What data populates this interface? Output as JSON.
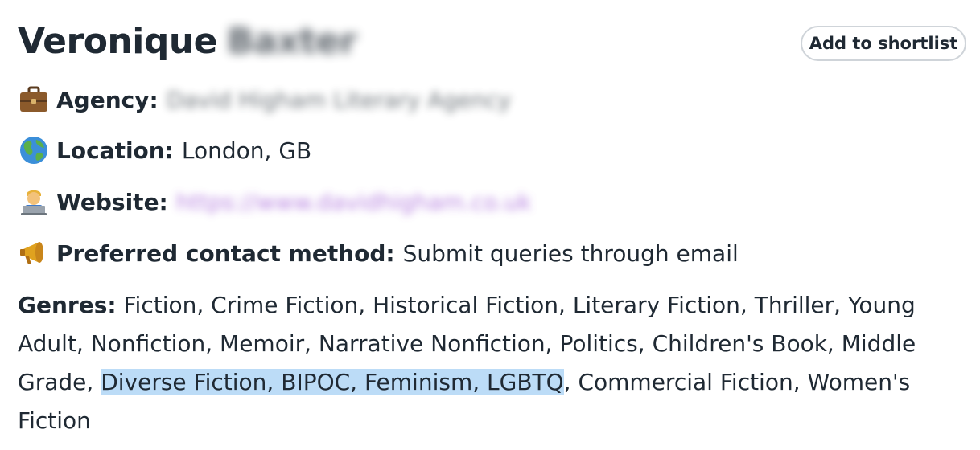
{
  "agent": {
    "first_name": "Veronique",
    "surname_blurred": "Baxter"
  },
  "shortlist_button": {
    "label": "Add to shortlist"
  },
  "fields": {
    "agency": {
      "icon": "briefcase-icon",
      "label": "Agency:",
      "value_blurred": "David Higham Literary Agency"
    },
    "location": {
      "icon": "globe-icon",
      "label": "Location:",
      "value": "London, GB"
    },
    "website": {
      "icon": "technologist-icon",
      "label": "Website:",
      "value_blurred": "https://www.davidhigham.co.uk"
    },
    "contact": {
      "icon": "megaphone-icon",
      "label": "Preferred contact method:",
      "value": "Submit queries through email"
    }
  },
  "genres": {
    "label": "Genres:",
    "before_highlight": "Fiction, Crime Fiction, Historical Fiction, Literary Fiction, Thriller, Young Adult, Nonfiction, Memoir, Narrative Nonfiction, Politics, Children's Book, Middle Grade,",
    "highlighted": "Diverse Fiction, BIPOC, Feminism, LGBTQ",
    "after_highlight": ", Commercial Fiction, Women's Fiction"
  },
  "colors": {
    "highlight": "#bcdcf7",
    "text": "#1f2933",
    "link_blur": "#a05bd6"
  }
}
